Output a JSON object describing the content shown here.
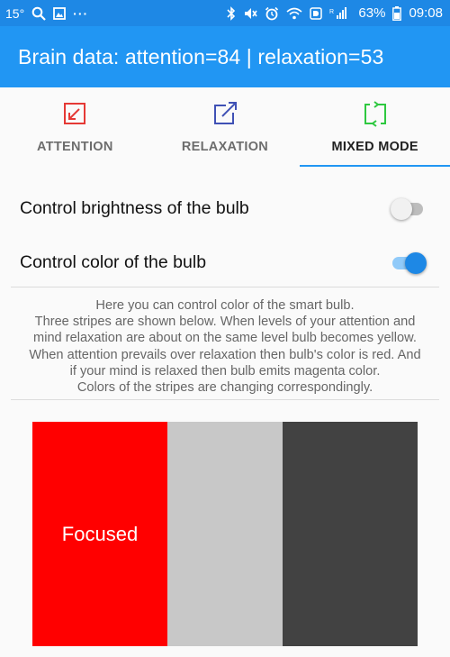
{
  "status_bar": {
    "temperature": "15°",
    "battery_percent": "63%",
    "time": "09:08",
    "left_icons": [
      "search-icon",
      "image-icon",
      "more-icon"
    ],
    "right_icons": [
      "bluetooth-icon",
      "mute-icon",
      "alarm-icon",
      "wifi-icon",
      "data-icon",
      "signal-icon",
      "battery-icon"
    ]
  },
  "app_bar": {
    "title": "Brain data: attention=84 | relaxation=53"
  },
  "tabs": [
    {
      "label": "ATTENTION",
      "icon": "arrow-down-left-icon",
      "color": "#e53935",
      "active": false
    },
    {
      "label": "RELAXATION",
      "icon": "arrow-up-right-icon",
      "color": "#3f51b5",
      "active": false
    },
    {
      "label": "MIXED MODE",
      "icon": "swap-icon",
      "color": "#2ec840",
      "active": true
    }
  ],
  "settings": {
    "brightness": {
      "label": "Control brightness of the bulb",
      "enabled": false
    },
    "color": {
      "label": "Control color of the bulb",
      "enabled": true
    }
  },
  "description": {
    "lines": [
      "Here you can control color of the smart bulb.",
      "Three stripes are shown below. When levels of your attention and",
      "mind relaxation are about on the same level bulb becomes yellow.",
      "When attention prevails over relaxation then bulb's color is red. And",
      "if your mind is relaxed then bulb emits magenta color.",
      "Colors of the stripes are changing correspondingly."
    ]
  },
  "stripes": [
    {
      "label": "Focused",
      "color": "#ff0000"
    },
    {
      "label": "",
      "color": "#c8c8c8"
    },
    {
      "label": "",
      "color": "#424242"
    }
  ]
}
